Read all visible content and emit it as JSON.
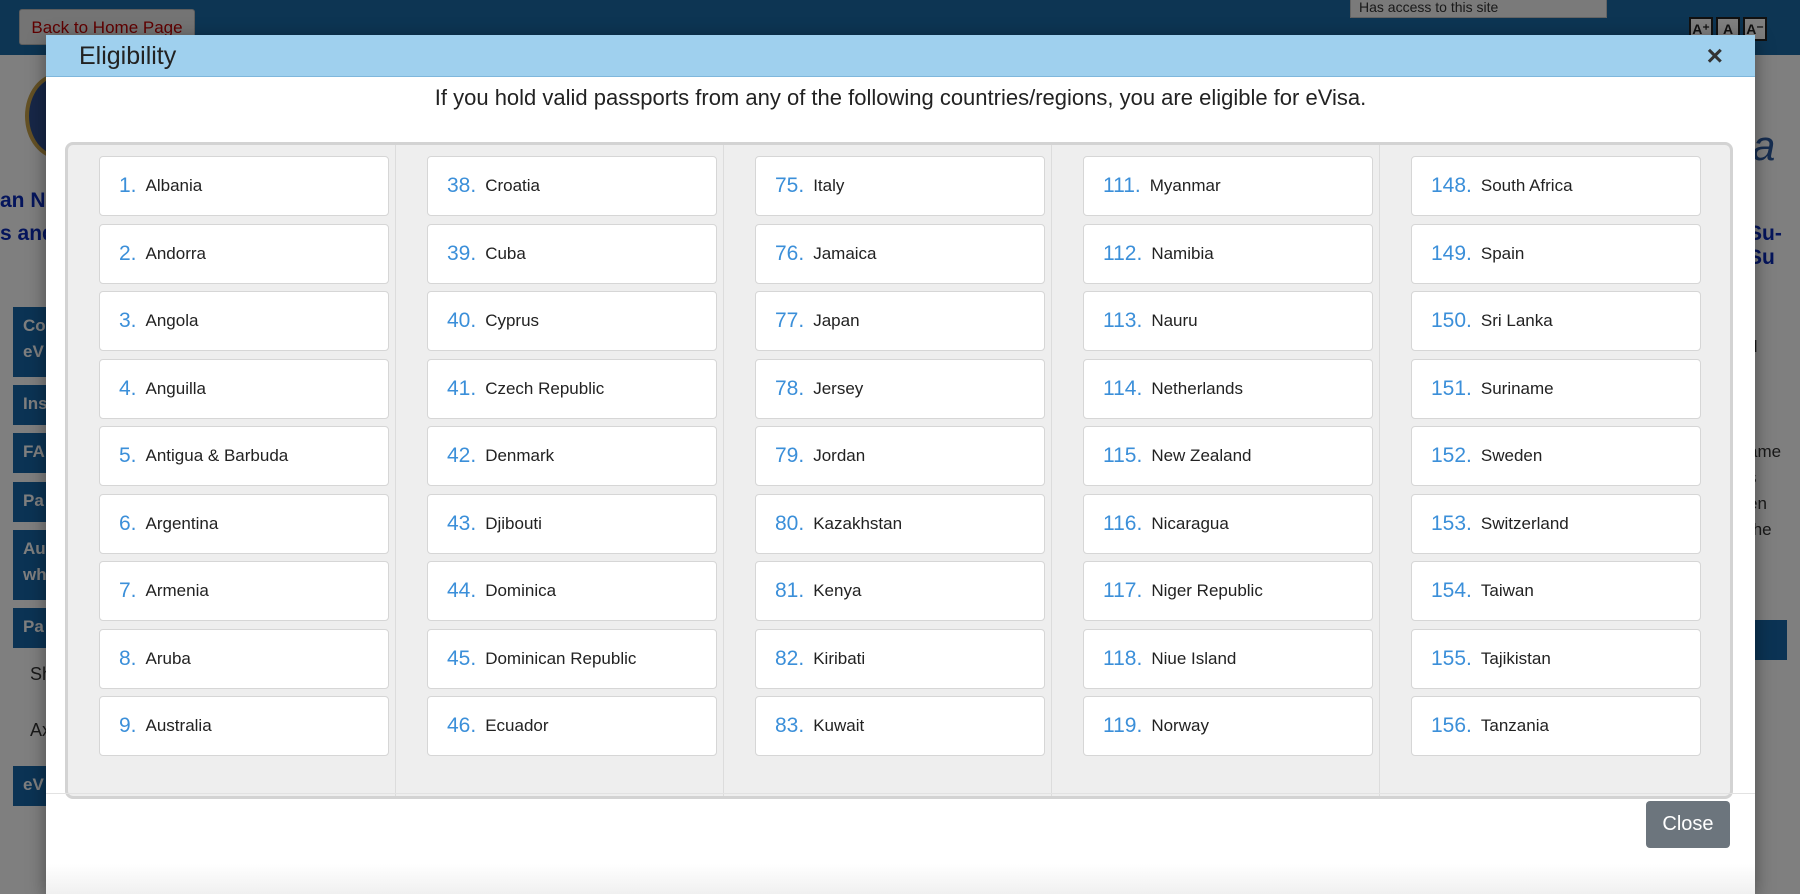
{
  "background": {
    "home_button": "Back to Home Page",
    "access_tip": "Has access to this site",
    "font_buttons": [
      "A⁺",
      "A",
      "A⁻"
    ],
    "header_right_fragment": "a",
    "nav_fragment_1": "an Na",
    "nav_fragment_2": "s and",
    "nav_fragment_right": "Su-Su",
    "sidebar_fragments": [
      "Co\neV",
      "Ins",
      "FA",
      "Pa",
      "Au\nwh",
      "Pa",
      "eV"
    ],
    "plain_fragments": [
      "Sh",
      "Ax"
    ],
    "right_text_fragments": [
      "d",
      "ame",
      "s",
      "en",
      "the"
    ]
  },
  "modal": {
    "title": "Eligibility",
    "close_symbol": "×",
    "intro": "If you hold valid passports from any of the following countries/regions, you are eligible for eVisa.",
    "close_button": "Close",
    "columns": [
      [
        {
          "num": "1.",
          "name": "Albania"
        },
        {
          "num": "2.",
          "name": "Andorra"
        },
        {
          "num": "3.",
          "name": "Angola"
        },
        {
          "num": "4.",
          "name": "Anguilla"
        },
        {
          "num": "5.",
          "name": "Antigua & Barbuda"
        },
        {
          "num": "6.",
          "name": "Argentina"
        },
        {
          "num": "7.",
          "name": "Armenia"
        },
        {
          "num": "8.",
          "name": "Aruba"
        },
        {
          "num": "9.",
          "name": "Australia"
        }
      ],
      [
        {
          "num": "38.",
          "name": "Croatia"
        },
        {
          "num": "39.",
          "name": "Cuba"
        },
        {
          "num": "40.",
          "name": "Cyprus"
        },
        {
          "num": "41.",
          "name": "Czech Republic"
        },
        {
          "num": "42.",
          "name": "Denmark"
        },
        {
          "num": "43.",
          "name": "Djibouti"
        },
        {
          "num": "44.",
          "name": "Dominica"
        },
        {
          "num": "45.",
          "name": "Dominican Republic"
        },
        {
          "num": "46.",
          "name": "Ecuador"
        }
      ],
      [
        {
          "num": "75.",
          "name": "Italy"
        },
        {
          "num": "76.",
          "name": "Jamaica"
        },
        {
          "num": "77.",
          "name": "Japan"
        },
        {
          "num": "78.",
          "name": "Jersey"
        },
        {
          "num": "79.",
          "name": "Jordan"
        },
        {
          "num": "80.",
          "name": "Kazakhstan"
        },
        {
          "num": "81.",
          "name": "Kenya"
        },
        {
          "num": "82.",
          "name": "Kiribati"
        },
        {
          "num": "83.",
          "name": "Kuwait"
        }
      ],
      [
        {
          "num": "111.",
          "name": "Myanmar"
        },
        {
          "num": "112.",
          "name": "Namibia"
        },
        {
          "num": "113.",
          "name": "Nauru"
        },
        {
          "num": "114.",
          "name": "Netherlands"
        },
        {
          "num": "115.",
          "name": "New Zealand"
        },
        {
          "num": "116.",
          "name": "Nicaragua"
        },
        {
          "num": "117.",
          "name": "Niger Republic"
        },
        {
          "num": "118.",
          "name": "Niue Island"
        },
        {
          "num": "119.",
          "name": "Norway"
        }
      ],
      [
        {
          "num": "148.",
          "name": "South Africa"
        },
        {
          "num": "149.",
          "name": "Spain"
        },
        {
          "num": "150.",
          "name": "Sri Lanka"
        },
        {
          "num": "151.",
          "name": "Suriname"
        },
        {
          "num": "152.",
          "name": "Sweden"
        },
        {
          "num": "153.",
          "name": "Switzerland"
        },
        {
          "num": "154.",
          "name": "Taiwan"
        },
        {
          "num": "155.",
          "name": "Tajikistan"
        },
        {
          "num": "156.",
          "name": "Tanzania"
        }
      ]
    ]
  },
  "colors": {
    "modal_header": "#9fd0ee",
    "number_accent": "#3b8fd9",
    "close_button": "#6c757d",
    "top_bar": "#1a6aa6"
  }
}
